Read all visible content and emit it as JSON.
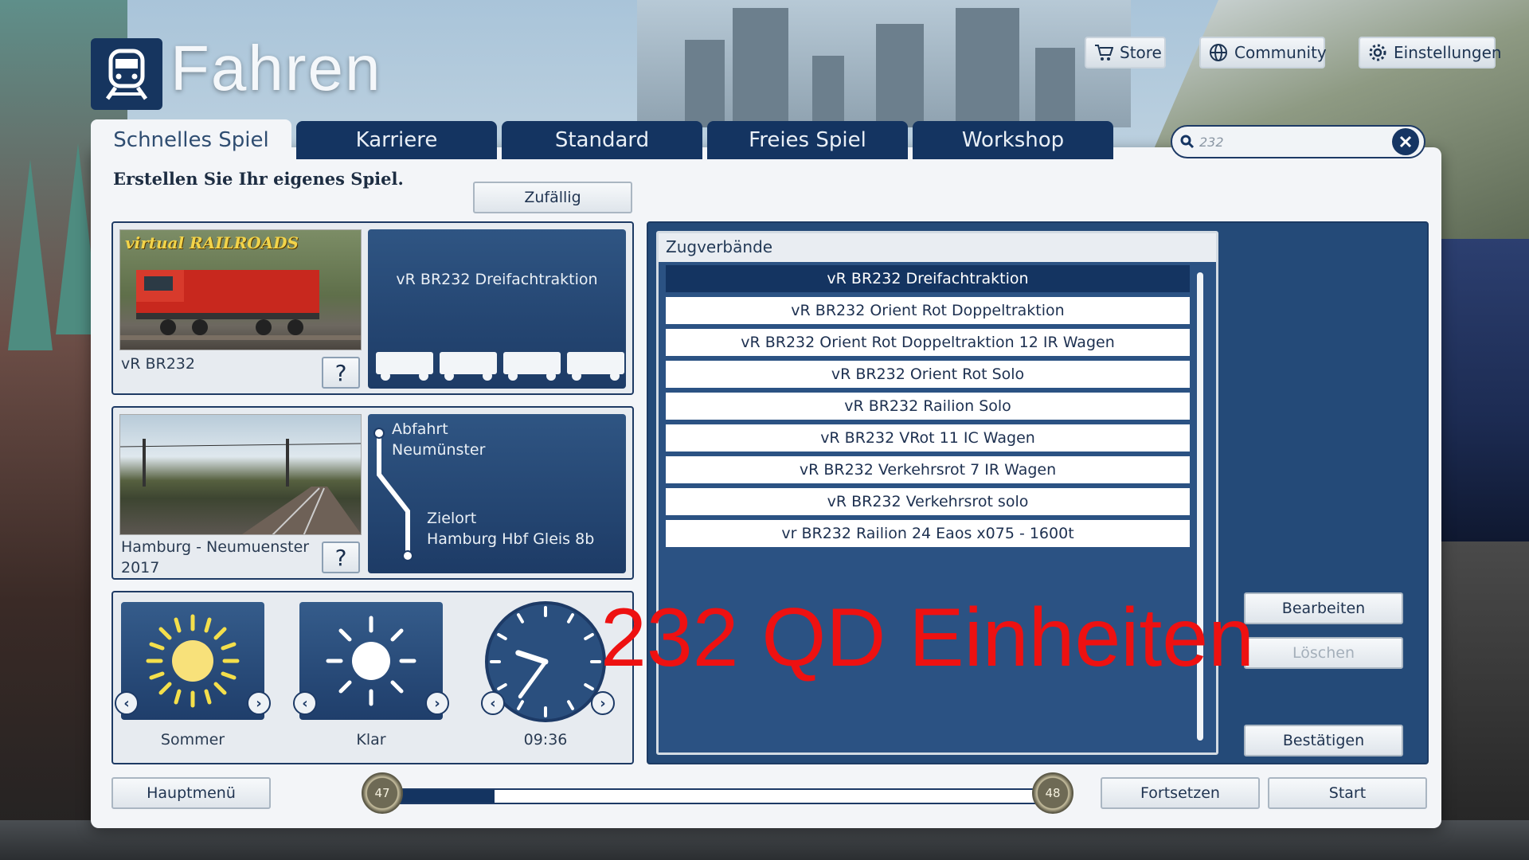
{
  "app": {
    "title": "Fahren"
  },
  "top_buttons": {
    "store": "Store",
    "community": "Community",
    "settings": "Einstellungen"
  },
  "tabs": [
    {
      "label": "Schnelles Spiel",
      "active": true
    },
    {
      "label": "Karriere",
      "active": false
    },
    {
      "label": "Standard",
      "active": false
    },
    {
      "label": "Freies Spiel",
      "active": false
    },
    {
      "label": "Workshop",
      "active": false
    }
  ],
  "search": {
    "value": "232"
  },
  "main": {
    "subtitle": "Erstellen Sie Ihr eigenes Spiel.",
    "random_button": "Zufällig"
  },
  "locomotive": {
    "logo_text": "virtual RAILROADS",
    "name": "vR BR232",
    "consist_title": "vR BR232 Dreifachtraktion",
    "wagon_count": 4,
    "help": "?"
  },
  "route": {
    "name_line1": "Hamburg - Neumuenster",
    "name_line2": "2017",
    "departure_label": "Abfahrt",
    "departure": "Neumünster",
    "destination_label": "Zielort",
    "destination": "Hamburg Hbf Gleis 8b",
    "help": "?"
  },
  "environment": {
    "season": "Sommer",
    "weather": "Klar",
    "time": "09:36",
    "clock_hour": 9,
    "clock_minute": 36
  },
  "consists": {
    "header": "Zugverbände",
    "items": [
      {
        "label": "vR BR232 Dreifachtraktion",
        "selected": true
      },
      {
        "label": "vR BR232 Orient Rot Doppeltraktion",
        "selected": false
      },
      {
        "label": "vR BR232 Orient Rot Doppeltraktion 12 IR Wagen",
        "selected": false
      },
      {
        "label": "vR BR232 Orient Rot Solo",
        "selected": false
      },
      {
        "label": "vR BR232 Railion Solo",
        "selected": false
      },
      {
        "label": "vR BR232 VRot 11 IC Wagen",
        "selected": false
      },
      {
        "label": "vR BR232 Verkehrsrot 7 IR Wagen",
        "selected": false
      },
      {
        "label": "vR BR232 Verkehrsrot solo",
        "selected": false
      },
      {
        "label": "vr BR232 Railion 24 Eaos x075 - 1600t",
        "selected": false
      }
    ]
  },
  "actions": {
    "edit": "Bearbeiten",
    "delete": "Löschen",
    "confirm": "Bestätigen"
  },
  "overlay_text": "232 QD Einheiten",
  "footer": {
    "main_menu": "Hauptmenü",
    "continue": "Fortsetzen",
    "start": "Start",
    "progress": {
      "left_value": "47",
      "right_value": "48",
      "fill_fraction": 0.15
    }
  },
  "colors": {
    "accent": "#143461",
    "overlay": "#ee1111"
  }
}
